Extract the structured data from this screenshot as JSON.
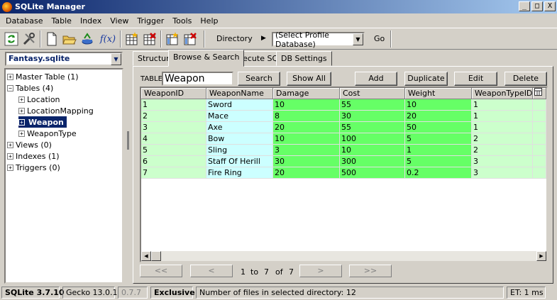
{
  "window": {
    "title": "SQLite Manager",
    "btn_min": "_",
    "btn_max": "□",
    "btn_close": "X"
  },
  "menu": [
    "Database",
    "Table",
    "Index",
    "View",
    "Trigger",
    "Tools",
    "Help"
  ],
  "toolbar": {
    "fx_label": "f(x)",
    "directory_label": "Directory",
    "directory_arrow": "▶",
    "profile_select": "(Select Profile Database)",
    "go_label": "Go"
  },
  "db_select": "Fantasy.sqlite",
  "tree": [
    {
      "label": "Master Table (1)",
      "level": 0,
      "selected": false
    },
    {
      "label": "Tables (4)",
      "level": 0,
      "selected": false
    },
    {
      "label": "Location",
      "level": 1,
      "selected": false
    },
    {
      "label": "LocationMapping",
      "level": 1,
      "selected": false
    },
    {
      "label": "Weapon",
      "level": 1,
      "selected": true
    },
    {
      "label": "WeaponType",
      "level": 1,
      "selected": false
    },
    {
      "label": "Views (0)",
      "level": 0,
      "selected": false
    },
    {
      "label": "Indexes (1)",
      "level": 0,
      "selected": false
    },
    {
      "label": "Triggers (0)",
      "level": 0,
      "selected": false
    }
  ],
  "tabs": [
    "Structure",
    "Browse & Search",
    "Execute SQL",
    "DB Settings"
  ],
  "browse": {
    "table_label": "TABLE",
    "table_value": "Weapon",
    "search_btn": "Search",
    "show_all_btn": "Show All",
    "add_btn": "Add",
    "duplicate_btn": "Duplicate",
    "edit_btn": "Edit",
    "delete_btn": "Delete"
  },
  "grid": {
    "columns": [
      "WeaponID",
      "WeaponName",
      "Damage",
      "Cost",
      "Weight",
      "WeaponTypeID"
    ],
    "rows": [
      [
        "1",
        "Sword",
        "10",
        "55",
        "10",
        "1"
      ],
      [
        "2",
        "Mace",
        "8",
        "30",
        "20",
        "1"
      ],
      [
        "3",
        "Axe",
        "20",
        "55",
        "50",
        "1"
      ],
      [
        "4",
        "Bow",
        "10",
        "100",
        "5",
        "2"
      ],
      [
        "5",
        "Sling",
        "3",
        "10",
        "1",
        "2"
      ],
      [
        "6",
        "Staff Of Herill",
        "30",
        "300",
        "5",
        "3"
      ],
      [
        "7",
        "Fire Ring",
        "20",
        "500",
        "0.2",
        "3"
      ]
    ]
  },
  "pager": {
    "first": "<<",
    "prev": "<",
    "next": ">",
    "last": ">>",
    "from": "1",
    "to_label": "to",
    "to": "7",
    "of_label": "of",
    "total": "7"
  },
  "status": {
    "sqlite_version": "SQLite 3.7.10",
    "gecko_version": "Gecko 13.0.1",
    "ext_version": "0.7.7",
    "mode": "Exclusive",
    "message": "Number of files in selected directory: 12",
    "elapsed": "ET: 1 ms"
  },
  "colors": {
    "id_cell": "#ccffcc",
    "text_cell": "#ccffff",
    "number_cell": "#66ff66",
    "selection": "#0a246a"
  }
}
